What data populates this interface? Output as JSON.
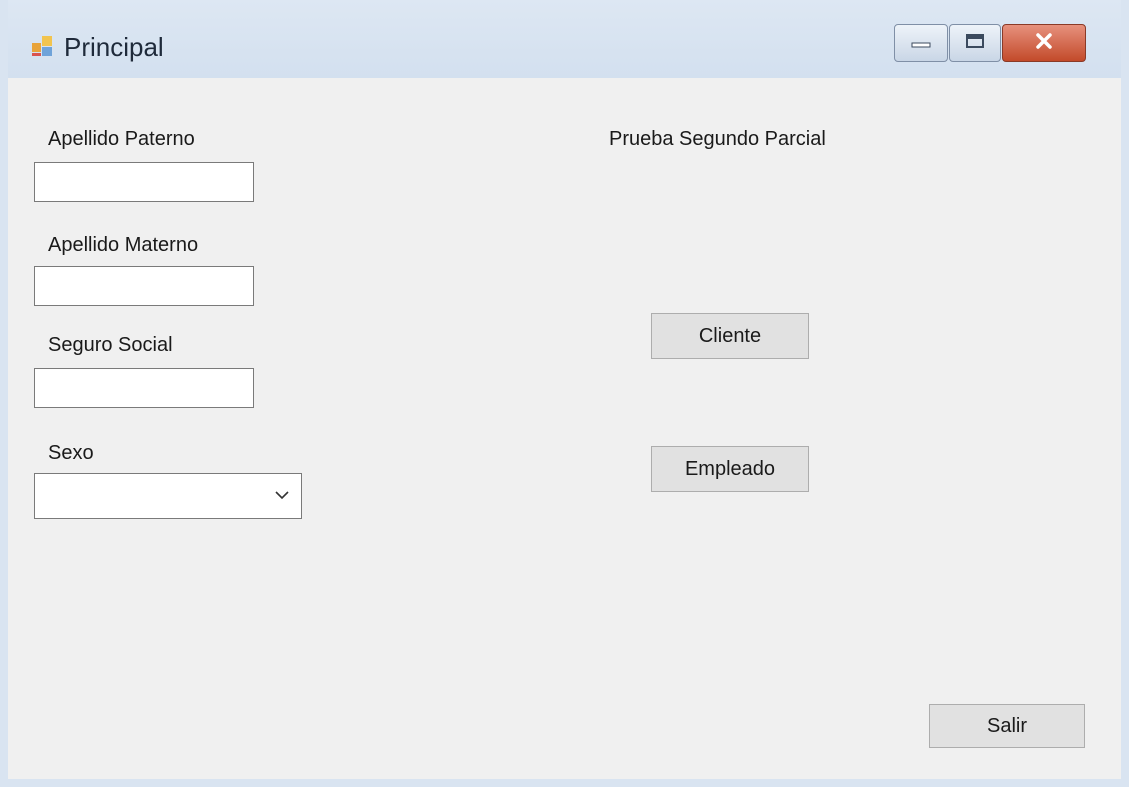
{
  "window": {
    "title": "Principal",
    "icon": "form-app-icon",
    "caption_buttons": [
      "minimize-icon",
      "maximize-icon",
      "close-icon"
    ]
  },
  "form": {
    "header_label": "Prueba Segundo Parcial",
    "fields": {
      "apellido_paterno": {
        "label": "Apellido Paterno",
        "value": ""
      },
      "apellido_materno": {
        "label": "Apellido Materno",
        "value": ""
      },
      "seguro_social": {
        "label": "Seguro Social",
        "value": ""
      },
      "sexo": {
        "label": "Sexo",
        "selected": ""
      }
    },
    "buttons": {
      "cliente": "Cliente",
      "empleado": "Empleado",
      "salir": "Salir"
    }
  },
  "colors": {
    "titlebar": "#d3e0ef",
    "client_bg": "#f0f0f0",
    "close_button": "#c34a2a",
    "button_bg": "#e1e1e1"
  }
}
